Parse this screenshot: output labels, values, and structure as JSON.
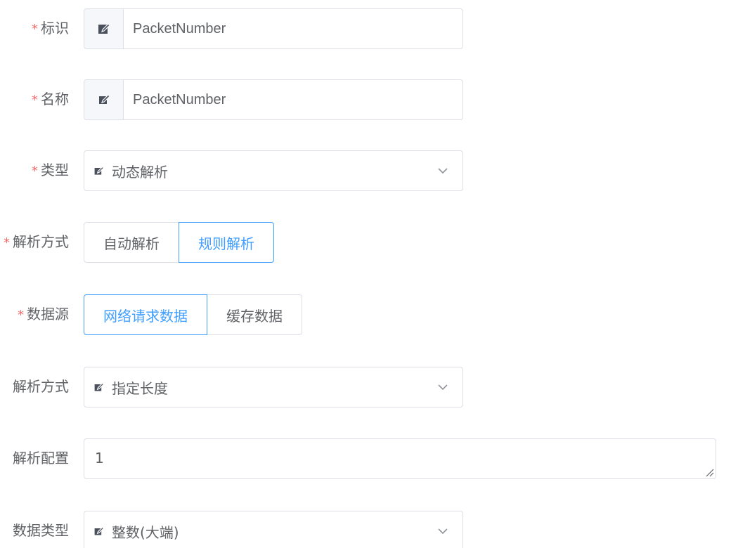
{
  "fields": {
    "identifier": {
      "label": "标识",
      "required_mark": "*",
      "value": "PacketNumber",
      "prepend_icon": "edit-icon"
    },
    "name": {
      "label": "名称",
      "required_mark": "*",
      "value": "PacketNumber",
      "prepend_icon": "edit-icon"
    },
    "type": {
      "label": "类型",
      "required_mark": "*",
      "selected": "动态解析",
      "icon": "edit-icon"
    },
    "parse_mode": {
      "label": "解析方式",
      "required_mark": "*",
      "options": [
        "自动解析",
        "规则解析"
      ],
      "selected": "规则解析"
    },
    "data_source": {
      "label": "数据源",
      "required_mark": "*",
      "options": [
        "网络请求数据",
        "缓存数据"
      ],
      "selected": "网络请求数据"
    },
    "parse_method": {
      "label": "解析方式",
      "selected": "指定长度",
      "icon": "edit-icon"
    },
    "parse_config": {
      "label": "解析配置",
      "value": "1"
    },
    "data_type": {
      "label": "数据类型",
      "selected": "整数(大端)",
      "icon": "edit-icon"
    }
  },
  "colors": {
    "label": "#606266",
    "required": "#f56c6c",
    "border": "#dcdfe6",
    "active": "#409eff",
    "prepend_bg": "#f5f7fa",
    "icon": "#4a4f5c"
  }
}
